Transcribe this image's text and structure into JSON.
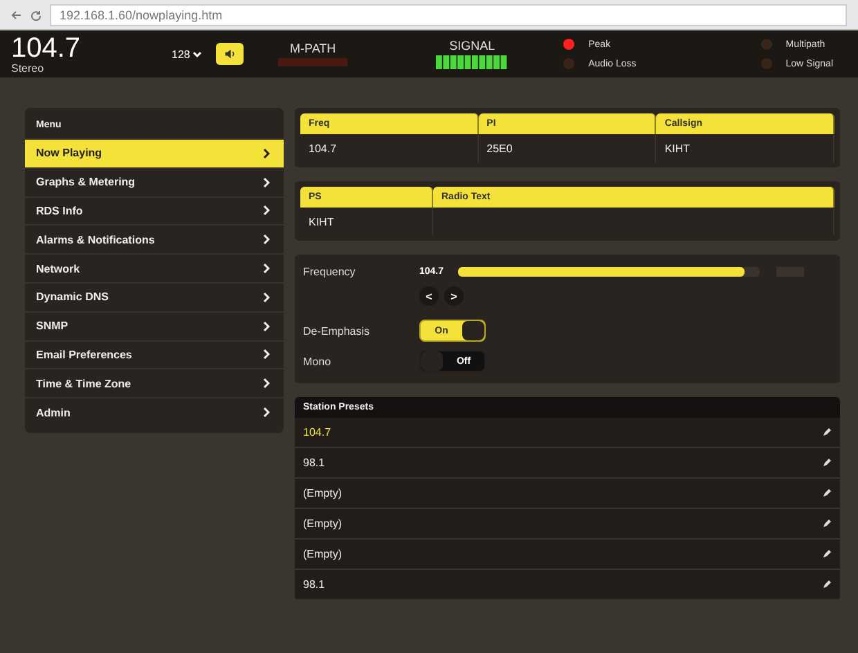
{
  "browser": {
    "url": "192.168.1.60/nowplaying.htm"
  },
  "header": {
    "frequency": "104.7",
    "mode": "Stereo",
    "dropdown": "128",
    "mpath_label": "M-PATH",
    "signal_label": "SIGNAL",
    "indicators": [
      {
        "label": "Peak",
        "on": true
      },
      {
        "label": "Audio Loss",
        "on": false
      },
      {
        "label": "Multipath",
        "on": false
      },
      {
        "label": "Low Signal",
        "on": false
      }
    ]
  },
  "menu": {
    "title": "Menu",
    "items": [
      {
        "label": "Now Playing",
        "selected": true
      },
      {
        "label": "Graphs & Metering",
        "selected": false
      },
      {
        "label": "RDS Info",
        "selected": false
      },
      {
        "label": "Alarms & Notifications",
        "selected": false
      },
      {
        "label": "Network",
        "selected": false
      },
      {
        "label": "Dynamic DNS",
        "selected": false
      },
      {
        "label": "SNMP",
        "selected": false
      },
      {
        "label": "Email Preferences",
        "selected": false
      },
      {
        "label": "Time & Time Zone",
        "selected": false
      },
      {
        "label": "Admin",
        "selected": false
      }
    ]
  },
  "info_table": {
    "columns": [
      "Freq",
      "PI",
      "Callsign"
    ],
    "row": [
      "104.7",
      "25E0",
      "KIHT"
    ]
  },
  "rds_table": {
    "columns": [
      "PS",
      "Radio Text"
    ],
    "row": [
      "KIHT"
    ]
  },
  "controls": {
    "frequency_label": "Frequency",
    "frequency_value": "104.7",
    "frequency": {
      "level": 0.95
    },
    "prev": "<",
    "next": ">",
    "toggles": [
      {
        "label": "De-Emphasis",
        "on": true,
        "text": "On"
      },
      {
        "label": "Mono",
        "on": false,
        "text": "Off"
      }
    ]
  },
  "presets": {
    "title": "Station Presets",
    "items": [
      {
        "label": "104.7",
        "selected": true
      },
      {
        "label": "98.1",
        "selected": false
      },
      {
        "label": "(Empty)",
        "selected": false
      },
      {
        "label": "(Empty)",
        "selected": false
      },
      {
        "label": "(Empty)",
        "selected": false
      },
      {
        "label": "98.1",
        "selected": false
      }
    ]
  }
}
